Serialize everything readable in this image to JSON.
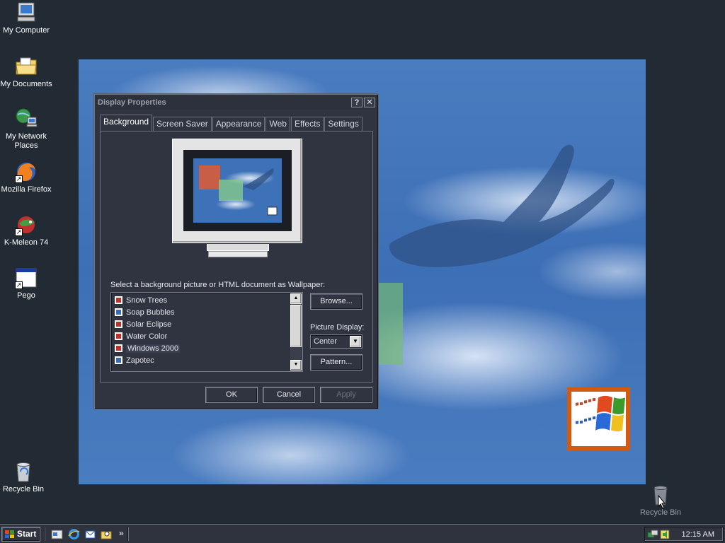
{
  "desktop": {
    "icons": [
      {
        "label": "My Computer"
      },
      {
        "label": "My Documents"
      },
      {
        "label": "My Network Places"
      },
      {
        "label": "Mozilla Firefox"
      },
      {
        "label": "K-Meleon 74"
      },
      {
        "label": "Pego"
      },
      {
        "label": "Recycle Bin"
      }
    ],
    "wallpaper_recycle_bin": "Recycle Bin"
  },
  "dialog": {
    "title": "Display Properties",
    "help_button": "?",
    "close_button": "✕",
    "tabs": [
      {
        "label": "Background",
        "active": true
      },
      {
        "label": "Screen Saver"
      },
      {
        "label": "Appearance"
      },
      {
        "label": "Web"
      },
      {
        "label": "Effects"
      },
      {
        "label": "Settings"
      }
    ],
    "wallpaper_label": "Select a background picture or HTML document as Wallpaper:",
    "wallpaper_list": [
      {
        "name": "Snow Trees",
        "icon": "html-doc-icon"
      },
      {
        "name": "Soap Bubbles",
        "icon": "picture-icon"
      },
      {
        "name": "Solar Eclipse",
        "icon": "html-doc-icon"
      },
      {
        "name": "Water Color",
        "icon": "html-doc-icon"
      },
      {
        "name": "Windows 2000",
        "icon": "html-doc-icon",
        "selected": true
      },
      {
        "name": "Zapotec",
        "icon": "picture-icon"
      }
    ],
    "browse_button": "Browse...",
    "picture_display_label": "Picture Display:",
    "picture_display_value": "Center",
    "pattern_button": "Pattern...",
    "ok_button": "OK",
    "cancel_button": "Cancel",
    "apply_button": "Apply"
  },
  "taskbar": {
    "start_label": "Start",
    "quick_launch_overflow": "»",
    "clock": "12:15 AM"
  },
  "colors": {
    "desktop_bg": "#222a34",
    "dialog_bg": "#2f3440",
    "wallpaper_blue": "#3d6fb6",
    "logo_frame": "#d45a10"
  }
}
